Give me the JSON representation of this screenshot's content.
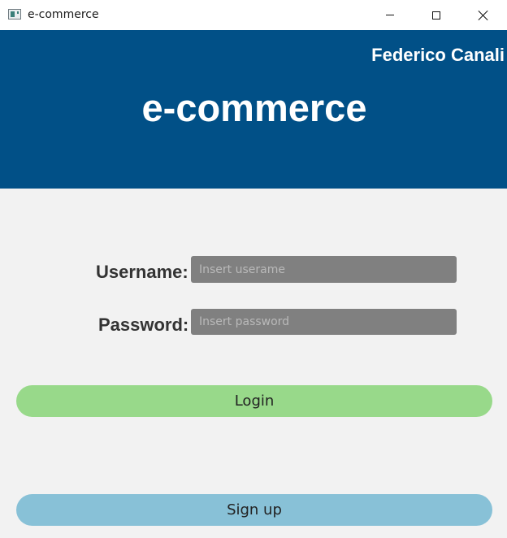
{
  "window": {
    "title": "e-commerce"
  },
  "header": {
    "user_name": "Federico Canali",
    "app_title": "e-commerce"
  },
  "form": {
    "username_label": "Username:",
    "username_placeholder": "Insert userame",
    "username_value": "",
    "password_label": "Password:",
    "password_placeholder": "Insert password",
    "password_value": ""
  },
  "buttons": {
    "login_label": "Login",
    "signup_label": "Sign up"
  },
  "colors": {
    "header_bg": "#015087",
    "login_bg": "#98d98a",
    "signup_bg": "#88c1d7",
    "input_bg": "#808080",
    "content_bg": "#f2f2f2"
  },
  "icons": {
    "app": "app-window-icon",
    "minimize": "minimize-icon",
    "maximize": "maximize-icon",
    "close": "close-icon"
  }
}
